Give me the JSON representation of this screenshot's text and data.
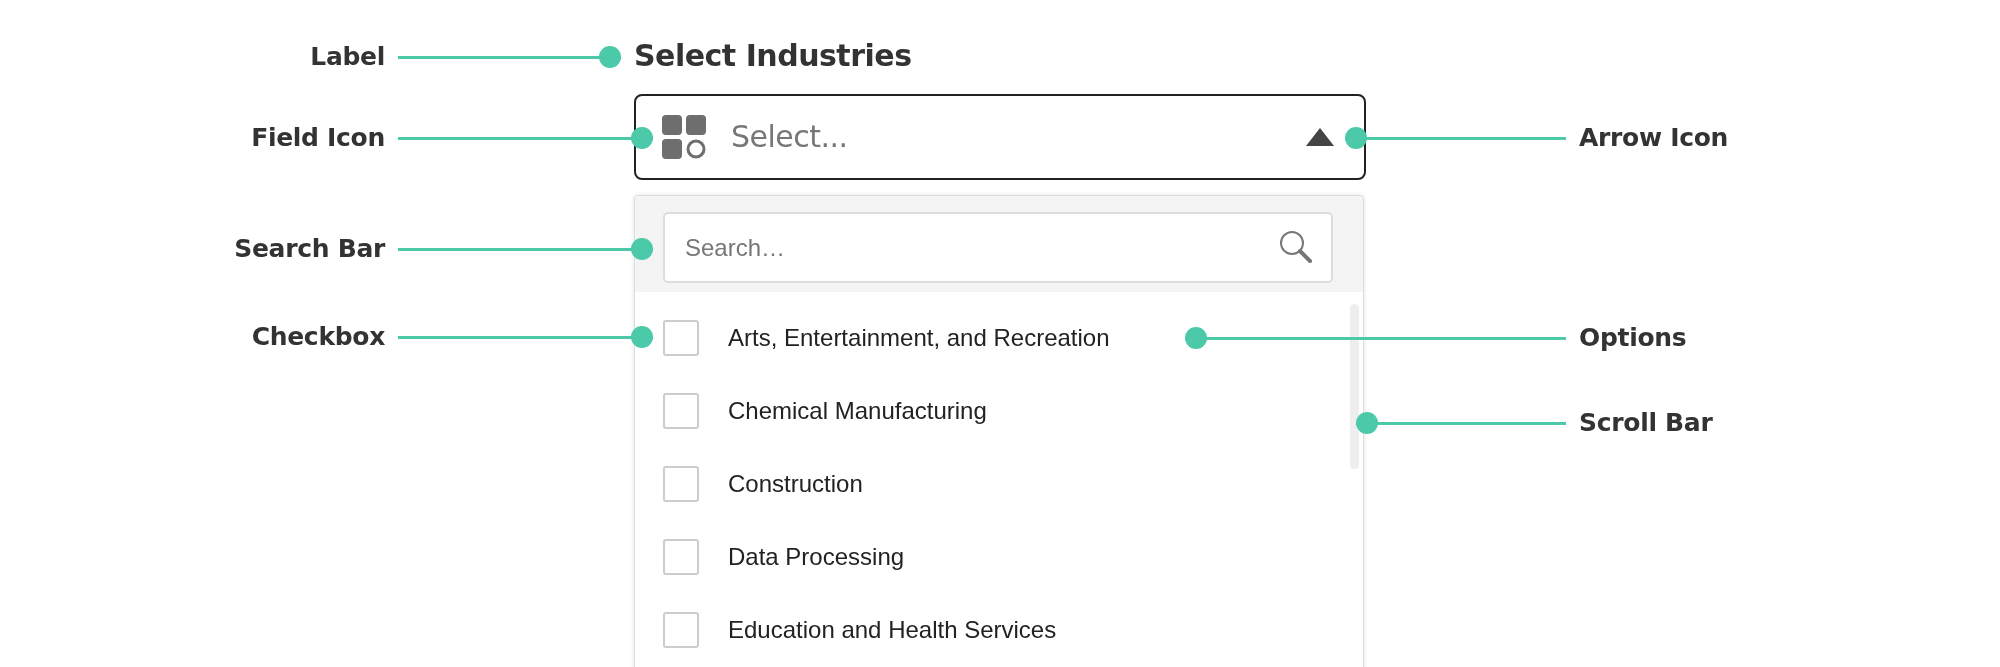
{
  "label": "Select Industries",
  "field": {
    "placeholder": "Select...",
    "expanded": true
  },
  "search": {
    "placeholder": "Search…"
  },
  "options": [
    {
      "label": "Arts, Entertainment, and Recreation",
      "checked": false
    },
    {
      "label": "Chemical Manufacturing",
      "checked": false
    },
    {
      "label": "Construction",
      "checked": false
    },
    {
      "label": "Data Processing",
      "checked": false
    },
    {
      "label": "Education and Health Services",
      "checked": false
    }
  ],
  "left_callouts": [
    "Label",
    "Field Icon",
    "Search Bar",
    "Checkbox"
  ],
  "right_callouts": [
    "Arrow Icon",
    "Options",
    "Scroll Bar"
  ]
}
